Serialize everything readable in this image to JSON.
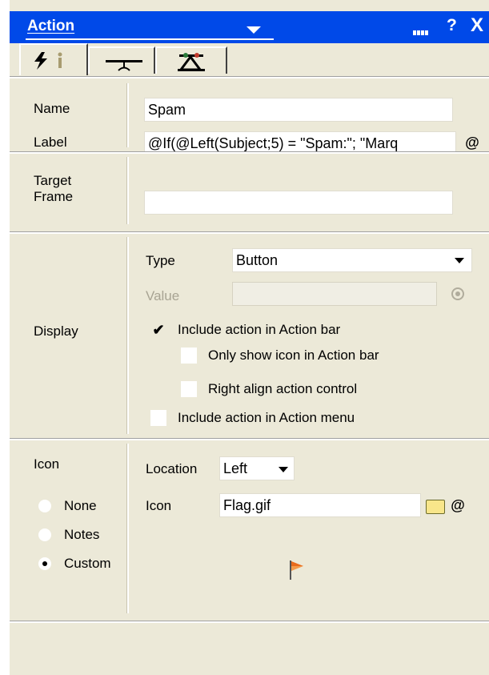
{
  "title": "Action",
  "titlebar": {
    "help": "?",
    "close": "X"
  },
  "tabs": [
    {
      "icon": "lightning-info-icon"
    },
    {
      "icon": "hide-when-icon"
    },
    {
      "icon": "advanced-icon"
    }
  ],
  "basics": {
    "name_label": "Name",
    "name_value": "Spam",
    "label_label": "Label",
    "label_value": "@If(@Left(Subject;5) = \"Spam:\"; \"Marq",
    "formula_button": "@"
  },
  "target": {
    "label": "Target\nFrame",
    "value": ""
  },
  "display": {
    "section_label": "Display",
    "type_label": "Type",
    "type_value": "Button",
    "value_label": "Value",
    "value_value": "",
    "check_mark": "✔",
    "include_action_bar": "Include action in Action bar",
    "only_show_icon": "Only show icon in Action bar",
    "right_align": "Right align action control",
    "include_action_menu": "Include action in Action menu"
  },
  "icon": {
    "section_label": "Icon",
    "options": [
      "None",
      "Notes",
      "Custom"
    ],
    "selected": "Custom",
    "location_label": "Location",
    "location_value": "Left",
    "icon_label": "Icon",
    "icon_value": "Flag.gif",
    "formula_button": "@"
  },
  "colors": {
    "titlebar": "#0049e8",
    "panel": "#ece9d8"
  }
}
